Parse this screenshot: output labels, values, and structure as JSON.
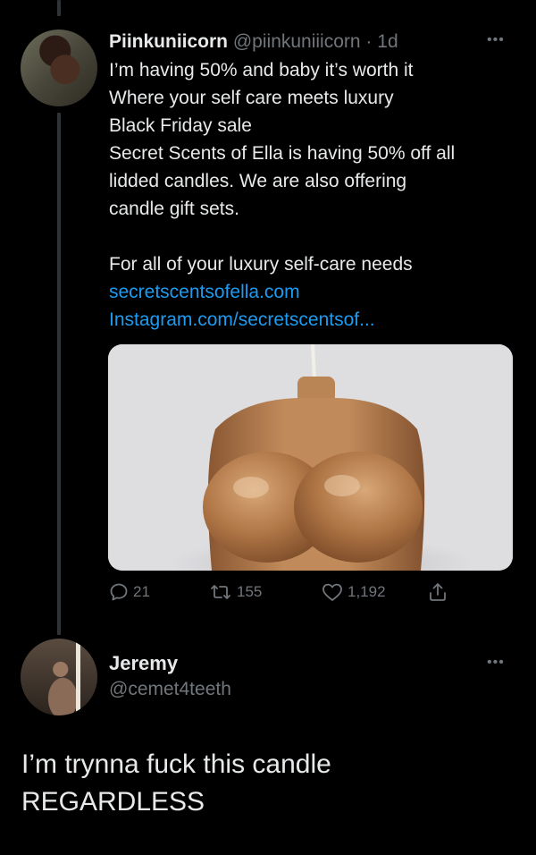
{
  "tweet": {
    "display_name": "Piinkuniicorn",
    "handle": "@piinkuniiicorn",
    "separator": "·",
    "time": "1d",
    "lines": [
      "I’m having 50% and baby it’s worth it",
      "Where your self care meets luxury",
      "Black Friday sale",
      "Secret Scents of Ella is having 50% off all",
      "lidded candles. We are also offering",
      "candle gift sets."
    ],
    "lines_after_gap": [
      "For all of your luxury self-care needs"
    ],
    "links": [
      "secretscentsofella.com",
      "Instagram.com/secretscentsof..."
    ],
    "actions": {
      "replies": "21",
      "retweets": "155",
      "likes": "1,192"
    }
  },
  "reply": {
    "display_name": "Jeremy",
    "handle": "@cemet4teeth",
    "lines": [
      "I’m trynna fuck this candle",
      "REGARDLESS"
    ]
  },
  "icons": {
    "more": "more-options-icon",
    "reply": "reply-icon",
    "retweet": "retweet-icon",
    "like": "like-icon",
    "share": "share-icon"
  },
  "colors": {
    "background": "#000000",
    "text": "#e7e9ea",
    "secondary": "#71767b",
    "link": "#1d9bf0"
  }
}
